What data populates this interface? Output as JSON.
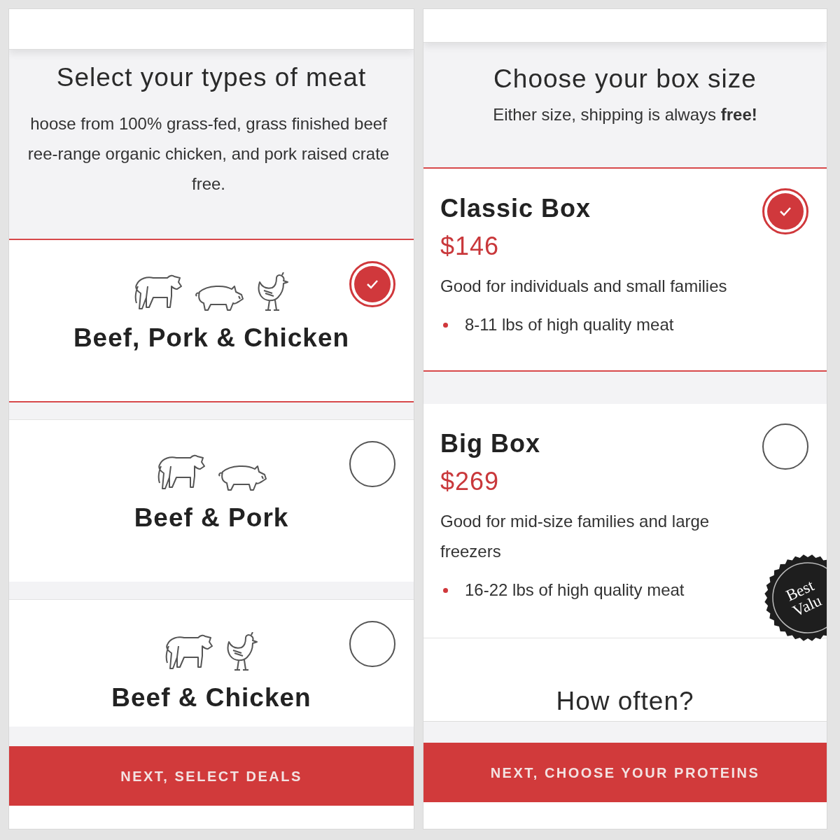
{
  "meat_screen": {
    "title": "Select your types of meat",
    "description_lines": [
      "hoose from 100% grass-fed, grass finished beef",
      "ree-range organic chicken, and pork raised crate",
      "free."
    ],
    "options": [
      {
        "label": "Beef, Pork & Chicken",
        "kind": "all",
        "selected": true
      },
      {
        "label": "Beef & Pork",
        "kind": "no_chicken",
        "selected": false
      },
      {
        "label": "Beef & Chicken",
        "kind": "no_pig",
        "selected": false
      }
    ],
    "button": "NEXT, SELECT DEALS"
  },
  "box_screen": {
    "title": "Choose your box size",
    "subtitle": "Either size, shipping is always **free!**",
    "boxes": [
      {
        "name": "Classic Box",
        "price": "$146",
        "description": "Good for individuals and small families",
        "bullets": [
          "8-11 lbs of high quality meat"
        ],
        "selected": true
      },
      {
        "name": "Big Box",
        "price": "$269",
        "description": "Good for mid-size families and large freezers",
        "bullets": [
          "16-22 lbs of high quality meat"
        ],
        "selected": false,
        "badge_lines": [
          "Best",
          "Valu"
        ]
      }
    ],
    "section_title": "How often?",
    "button": "NEXT, CHOOSE YOUR PROTEINS"
  }
}
